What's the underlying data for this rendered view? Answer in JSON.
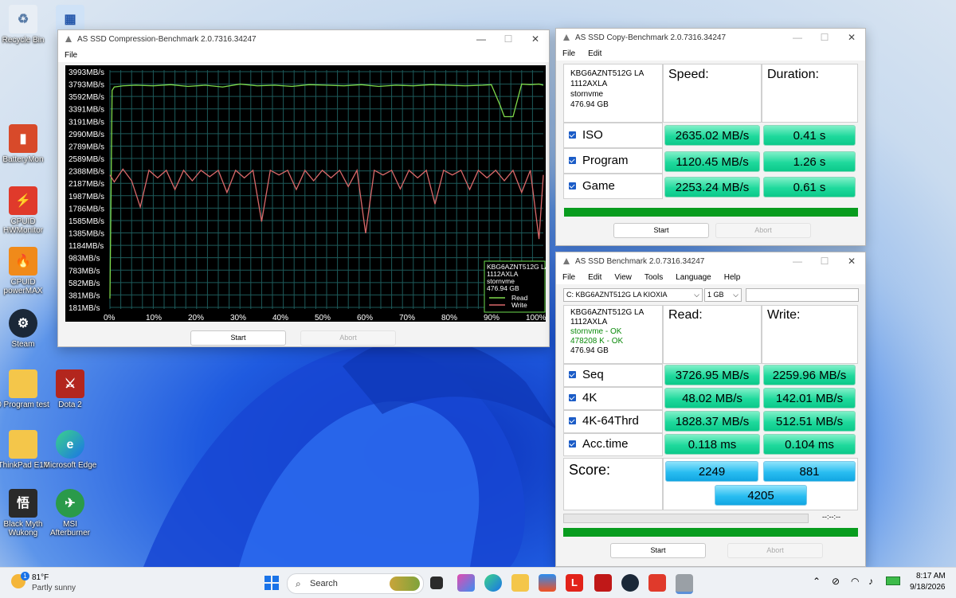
{
  "desktop": {
    "icons": [
      {
        "label": "Recycle Bin"
      },
      {
        "label": "BatteryMon"
      },
      {
        "label": "CPUID HWMonitor"
      },
      {
        "label": "CPUID powerMAX"
      },
      {
        "label": "Steam"
      },
      {
        "label": "0 Program test"
      },
      {
        "label": "ThinkPad E14"
      },
      {
        "label": "Black Myth Wukong"
      },
      {
        "label": "Dota 2"
      },
      {
        "label": "Microsoft Edge"
      },
      {
        "label": "MSI Afterburner"
      }
    ]
  },
  "compression_window": {
    "title": "AS SSD Compression-Benchmark 2.0.7316.34247",
    "menu": [
      "File"
    ],
    "start_label": "Start",
    "abort_label": "Abort",
    "legend": {
      "lines": [
        "KBG6AZNT512G LA",
        "1112AXLA",
        "stornvme",
        "476.94 GB"
      ],
      "read_label": "Read",
      "write_label": "Write"
    }
  },
  "chart_data": {
    "type": "line",
    "title": "",
    "y_tick_labels": [
      "3993MB/s",
      "3793MB/s",
      "3592MB/s",
      "3391MB/s",
      "3191MB/s",
      "2990MB/s",
      "2789MB/s",
      "2589MB/s",
      "2388MB/s",
      "2187MB/s",
      "1987MB/s",
      "1786MB/s",
      "1585MB/s",
      "1385MB/s",
      "1184MB/s",
      "983MB/s",
      "783MB/s",
      "582MB/s",
      "381MB/s",
      "181MB/s"
    ],
    "x_tick_labels": [
      "0%",
      "10%",
      "20%",
      "30%",
      "40%",
      "50%",
      "60%",
      "70%",
      "80%",
      "90%",
      "100%"
    ],
    "xlim": [
      0,
      100
    ],
    "ylim": [
      0,
      4100
    ],
    "grid": true,
    "series": [
      {
        "name": "Read",
        "color": "#7fd94a",
        "x": [
          0,
          0.5,
          1,
          3,
          6,
          10,
          14,
          18,
          22,
          26,
          30,
          34,
          38,
          42,
          46,
          50,
          54,
          58,
          62,
          66,
          70,
          74,
          78,
          82,
          86,
          88,
          90,
          91,
          93,
          95,
          97,
          99,
          100
        ],
        "y": [
          180,
          3750,
          3810,
          3830,
          3840,
          3830,
          3850,
          3820,
          3840,
          3810,
          3860,
          3830,
          3840,
          3820,
          3850,
          3840,
          3830,
          3850,
          3820,
          3840,
          3830,
          3850,
          3840,
          3830,
          3840,
          3850,
          3500,
          3300,
          3300,
          3860,
          3850,
          3860,
          3840
        ]
      },
      {
        "name": "Write",
        "color": "#d9696a",
        "x": [
          0,
          1,
          3,
          5,
          7,
          9,
          11,
          13,
          15,
          17,
          19,
          21,
          23,
          25,
          27,
          29,
          31,
          33,
          35,
          37,
          39,
          41,
          43,
          45,
          47,
          49,
          51,
          53,
          55,
          57,
          59,
          61,
          63,
          65,
          67,
          69,
          71,
          73,
          75,
          77,
          79,
          81,
          83,
          85,
          87,
          89,
          91,
          93,
          95,
          97,
          99,
          100
        ],
        "y": [
          2300,
          2180,
          2400,
          2200,
          1750,
          2380,
          2250,
          2380,
          2050,
          2380,
          2200,
          2380,
          2270,
          2380,
          2000,
          2380,
          2250,
          2380,
          1500,
          2380,
          2300,
          2380,
          2050,
          2380,
          2200,
          2380,
          2250,
          2380,
          2100,
          2380,
          1300,
          2380,
          2300,
          2380,
          2060,
          2380,
          2250,
          2380,
          1800,
          2380,
          2300,
          2380,
          2050,
          2380,
          2250,
          2380,
          2200,
          2380,
          2000,
          2380,
          1200,
          2300
        ]
      }
    ],
    "legend_position": "bottom-right"
  },
  "copy_window": {
    "title": "AS SSD Copy-Benchmark 2.0.7316.34247",
    "menu": [
      "File",
      "Edit"
    ],
    "device": [
      "KBG6AZNT512G LA",
      "1112AXLA",
      "stornvme",
      "476.94 GB"
    ],
    "col_speed": "Speed:",
    "col_duration": "Duration:",
    "rows": [
      {
        "label": "ISO",
        "speed": "2635.02 MB/s",
        "duration": "0.41 s"
      },
      {
        "label": "Program",
        "speed": "1120.45 MB/s",
        "duration": "1.26 s"
      },
      {
        "label": "Game",
        "speed": "2253.24 MB/s",
        "duration": "0.61 s"
      }
    ],
    "progress": 1.0,
    "start_label": "Start",
    "abort_label": "Abort"
  },
  "bench_window": {
    "title": "AS SSD Benchmark 2.0.7316.34247",
    "menu": [
      "File",
      "Edit",
      "View",
      "Tools",
      "Language",
      "Help"
    ],
    "drive_select": "C: KBG6AZNT512G LA KIOXIA",
    "size_select": "1 GB",
    "device": [
      "KBG6AZNT512G LA",
      "1112AXLA",
      "stornvme - OK",
      "478208 K - OK",
      "476.94 GB"
    ],
    "device_ok_color": "#0a8a0a",
    "col_read": "Read:",
    "col_write": "Write:",
    "rows": [
      {
        "label": "Seq",
        "read": "3726.95 MB/s",
        "write": "2259.96 MB/s"
      },
      {
        "label": "4K",
        "read": "48.02 MB/s",
        "write": "142.01 MB/s"
      },
      {
        "label": "4K-64Thrd",
        "read": "1828.37 MB/s",
        "write": "512.51 MB/s"
      },
      {
        "label": "Acc.time",
        "read": "0.118 ms",
        "write": "0.104 ms"
      }
    ],
    "score_label": "Score:",
    "score_read": "2249",
    "score_write": "881",
    "score_total": "4205",
    "time_text": "--:--:--",
    "progress": 1.0,
    "start_label": "Start",
    "abort_label": "Abort"
  },
  "taskbar": {
    "weather_temp": "81°F",
    "weather_text": "Partly sunny",
    "weather_badge": "1",
    "search_placeholder": "Search",
    "time": "8:17 AM",
    "date": "9/18/2026"
  }
}
